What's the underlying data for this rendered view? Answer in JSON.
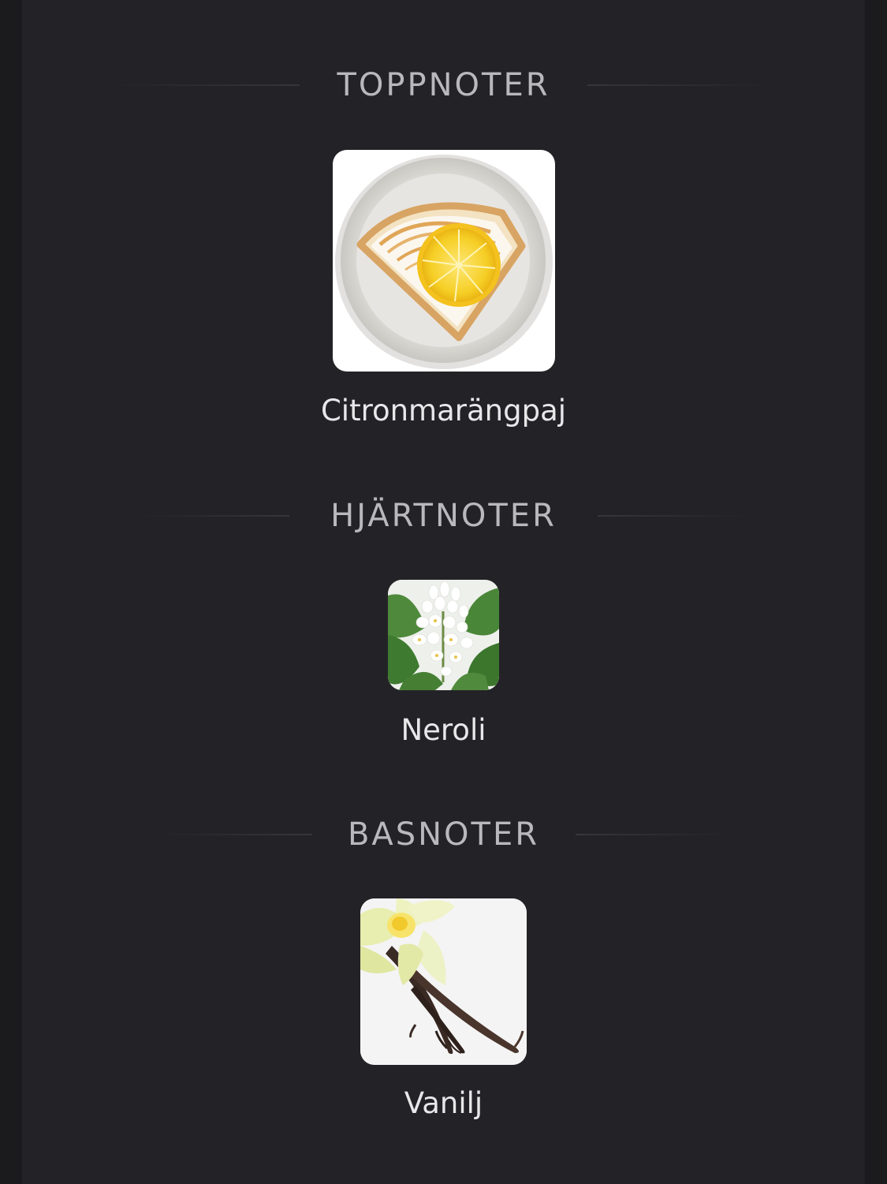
{
  "sections": [
    {
      "heading": "TOPPNOTER",
      "note": {
        "label": "Citronmarängpaj",
        "icon": "lemon-meringue-pie-image"
      }
    },
    {
      "heading": "HJÄRTNOTER",
      "note": {
        "label": "Neroli",
        "icon": "neroli-blossom-image"
      }
    },
    {
      "heading": "BASNOTER",
      "note": {
        "label": "Vanilj",
        "icon": "vanilla-flower-image"
      }
    }
  ],
  "colors": {
    "background": "#1b1b1e",
    "panel": "#232327",
    "heading": "#b9b9bd",
    "label": "#e8e8ea"
  }
}
